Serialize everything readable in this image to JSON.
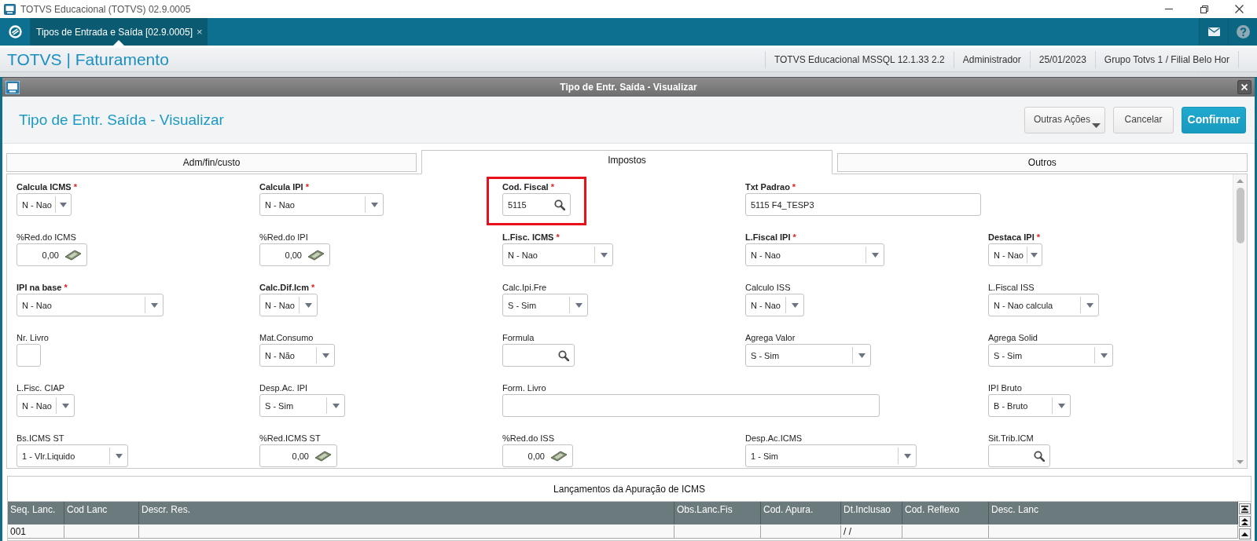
{
  "window": {
    "title": "TOTVS Educacional (TOTVS) 02.9.0005"
  },
  "nav": {
    "tabs": [
      {
        "label": "Tipos de Entrada e Saída [02.9.0005]",
        "close": "×",
        "selected": true
      }
    ]
  },
  "header": {
    "brand": "TOTVS | Faturamento",
    "status": [
      "TOTVS Educacional MSSQL 12.1.33 2.2",
      "Administrador",
      "25/01/2023",
      "Grupo Totvs 1 / Filial Belo Hor"
    ]
  },
  "dialog": {
    "title": "Tipo de Entr. Saída - Visualizar",
    "heading": "Tipo de Entr. Saída - Visualizar",
    "buttons": [
      {
        "label": "Outras Ações",
        "kind": "menu"
      },
      {
        "label": "Cancelar",
        "kind": "default"
      },
      {
        "label": "Confirmar",
        "kind": "primary"
      }
    ],
    "tabs": [
      {
        "label": "Adm/fin/custo",
        "selected": false
      },
      {
        "label": "Impostos",
        "selected": true
      },
      {
        "label": "Outros",
        "selected": false
      }
    ],
    "form": {
      "rows": [
        {
          "fields": [
            {
              "label": "Calcula ICMS",
              "required": true,
              "mark": "*",
              "kind": "select",
              "value": "N - Nao",
              "highlighted": false
            },
            {
              "label": "Calcula IPI",
              "required": true,
              "mark": "*",
              "kind": "select",
              "value": "N - Nao",
              "highlighted": false
            },
            {
              "label": "Cod. Fiscal",
              "required": true,
              "mark": "*",
              "kind": "lookup",
              "value": "5115",
              "highlighted": true
            },
            {
              "label": "Txt Padrao",
              "required": true,
              "mark": "*",
              "kind": "text",
              "value": "5115 F4_TESP3",
              "highlighted": false
            }
          ]
        },
        {
          "fields": [
            {
              "label": "%Red.do ICMS",
              "required": false,
              "kind": "money",
              "value": "0,00",
              "highlighted": false
            },
            {
              "label": "%Red.do IPI",
              "required": false,
              "kind": "money",
              "value": "0,00",
              "highlighted": false
            },
            {
              "label": "L.Fisc. ICMS",
              "required": true,
              "mark": "*",
              "kind": "select",
              "value": "N - Nao",
              "highlighted": false
            },
            {
              "label": "L.Fiscal IPI",
              "required": true,
              "mark": "*",
              "kind": "select",
              "value": "N - Nao",
              "highlighted": false
            },
            {
              "label": "Destaca IPI",
              "required": true,
              "mark": "*",
              "kind": "select",
              "value": "N - Nao",
              "highlighted": false
            }
          ]
        },
        {
          "fields": [
            {
              "label": "IPI na base",
              "required": true,
              "mark": "*",
              "kind": "select",
              "value": "N - Nao",
              "highlighted": false
            },
            {
              "label": "Calc.Dif.Icm",
              "required": true,
              "mark": "*",
              "kind": "select",
              "value": "N - Nao",
              "highlighted": false
            },
            {
              "label": "Calc.Ipi.Fre",
              "required": false,
              "kind": "select",
              "value": "S - Sim",
              "highlighted": false
            },
            {
              "label": "Calculo ISS",
              "required": false,
              "kind": "select",
              "value": "N - Nao",
              "highlighted": false
            },
            {
              "label": "L.Fiscal ISS",
              "required": false,
              "kind": "select",
              "value": "N - Nao calcula",
              "highlighted": false
            }
          ]
        },
        {
          "fields": [
            {
              "label": "Nr. Livro",
              "required": false,
              "kind": "text",
              "highlighted": false
            },
            {
              "label": "Mat.Consumo",
              "required": false,
              "kind": "select",
              "value": "N - Não",
              "highlighted": false
            },
            {
              "label": "Formula",
              "required": false,
              "kind": "lookup",
              "highlighted": false
            },
            {
              "label": "Agrega Valor",
              "required": false,
              "kind": "select",
              "value": "S - Sim",
              "highlighted": false
            },
            {
              "label": "Agrega Solid",
              "required": false,
              "kind": "select",
              "value": "S - Sim",
              "highlighted": false
            }
          ]
        },
        {
          "fields": [
            {
              "label": "L.Fisc. CIAP",
              "required": false,
              "kind": "select",
              "value": "N - Nao",
              "highlighted": false
            },
            {
              "label": "Desp.Ac. IPI",
              "required": false,
              "kind": "select",
              "value": "S - Sim",
              "highlighted": false
            },
            {
              "label": "Form. Livro",
              "required": false,
              "kind": "text",
              "highlighted": false
            },
            {
              "label": "IPI Bruto",
              "required": false,
              "kind": "select",
              "value": "B - Bruto",
              "highlighted": false
            }
          ]
        },
        {
          "fields": [
            {
              "label": "Bs.ICMS ST",
              "required": false,
              "kind": "select",
              "value": "1 - Vlr.Liquido",
              "highlighted": false
            },
            {
              "label": "%Red.ICMS ST",
              "required": false,
              "kind": "money",
              "value": "0,00",
              "highlighted": false
            },
            {
              "label": "%Red.do ISS",
              "required": false,
              "kind": "money",
              "value": "0,00",
              "highlighted": false
            },
            {
              "label": "Desp.Ac.ICMS",
              "required": false,
              "kind": "select",
              "value": "1 - Sim",
              "highlighted": false
            },
            {
              "label": "Sit.Trib.ICM",
              "required": false,
              "kind": "lookup",
              "highlighted": false
            }
          ]
        }
      ]
    },
    "grid": {
      "title": "Lançamentos da Apuração de ICMS",
      "columns": [
        "Seq. Lanc.",
        "Cod Lanc",
        "Descr. Res.",
        "Obs.Lanc.Fis",
        "Cod. Apura.",
        "Dt.Inclusao",
        "Cod. Reflexo",
        "Desc. Lanc"
      ],
      "rows": [
        {
          "cells": [
            "001",
            null,
            null,
            null,
            null,
            "/ /",
            null,
            null
          ]
        }
      ]
    }
  }
}
